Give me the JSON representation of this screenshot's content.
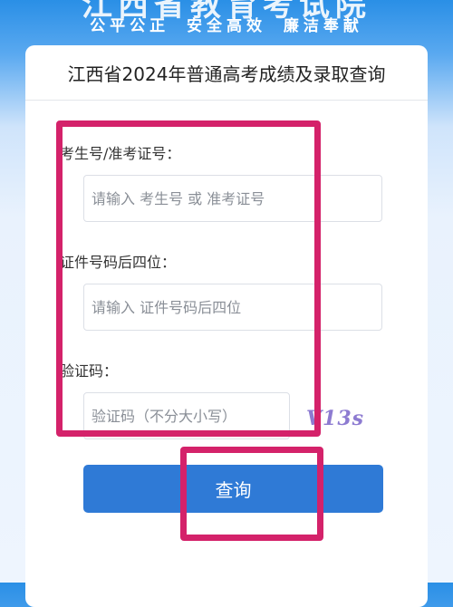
{
  "hero": {
    "title": "江西省教育考试院",
    "subtitle": "公平公正 安全高效 廉洁奉献"
  },
  "card": {
    "title": "江西省2024年普通高考成绩及录取查询"
  },
  "form": {
    "exam_id": {
      "label": "考生号/准考证号：",
      "placeholder": "请输入 考生号 或 准考证号",
      "value": ""
    },
    "id_last4": {
      "label": "证件号码后四位：",
      "placeholder": "请输入 证件号码后四位",
      "value": ""
    },
    "captcha": {
      "label": "验证码：",
      "placeholder": "验证码（不分大小写）",
      "value": "",
      "image_text": "V13s"
    },
    "submit_label": "查询"
  },
  "colors": {
    "accent": "#2f7ad6",
    "highlight": "#d4226a"
  }
}
